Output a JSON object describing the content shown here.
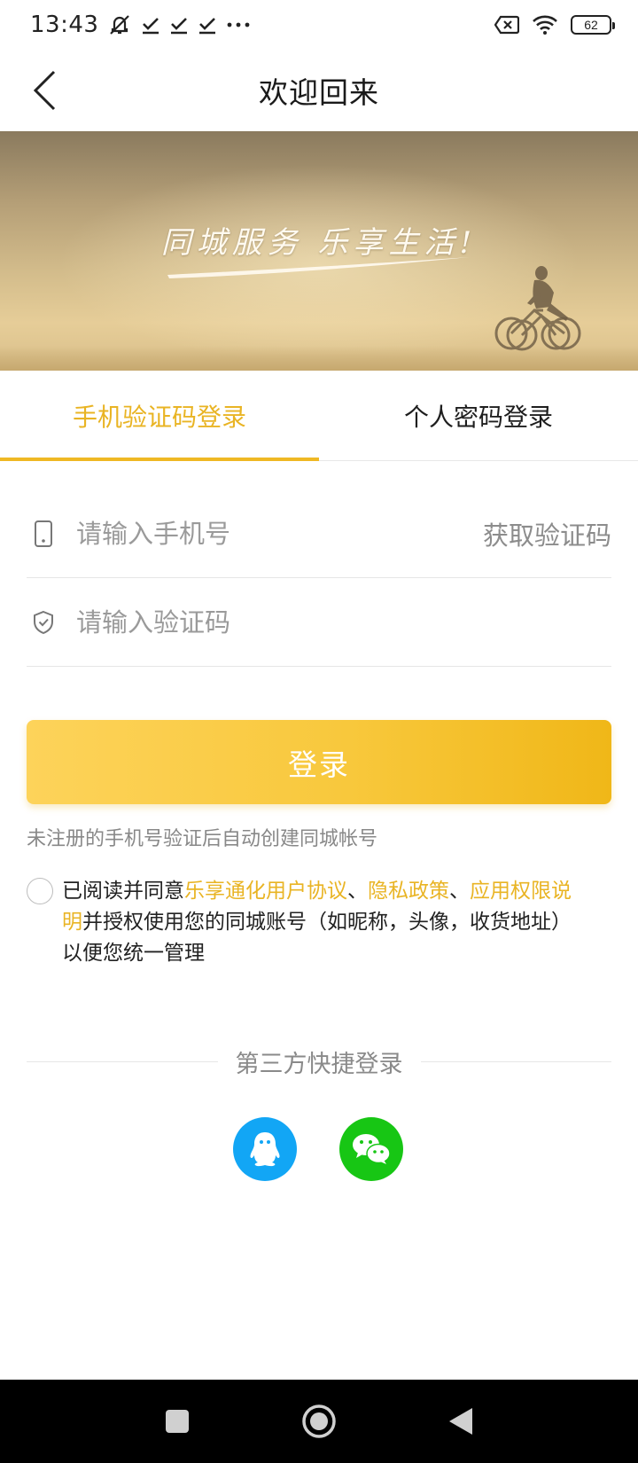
{
  "status_bar": {
    "time": "13:43",
    "battery": "62",
    "icons": [
      "mute-icon",
      "check-icon",
      "check-icon",
      "check-icon",
      "more-icon",
      "no-sim-icon",
      "wifi-icon",
      "battery-icon"
    ]
  },
  "header": {
    "title": "欢迎回来",
    "back_icon": "chevron-left-icon"
  },
  "banner": {
    "slogan": "同城服务 乐享生活!"
  },
  "tabs": [
    {
      "label": "手机验证码登录",
      "active": true
    },
    {
      "label": "个人密码登录",
      "active": false
    }
  ],
  "form": {
    "phone_placeholder": "请输入手机号",
    "phone_value": "",
    "get_code_label": "获取验证码",
    "code_placeholder": "请输入验证码",
    "code_value": ""
  },
  "login_button": "登录",
  "hint": "未注册的手机号验证后自动创建同城帐号",
  "agreement": {
    "checked": false,
    "prefix": "已阅读并同意",
    "link1": "乐享通化用户协议",
    "sep1": "、",
    "link2": "隐私政策",
    "sep2": "、",
    "link3": "应用权限说明",
    "suffix": "并授权使用您的同城账号（如昵称，头像，收货地址）以便您统一管理"
  },
  "third_party": {
    "label": "第三方快捷登录",
    "providers": [
      "qq-icon",
      "wechat-icon"
    ]
  },
  "colors": {
    "accent": "#e9b424",
    "button_start": "#fdd35a",
    "button_end": "#f0b718",
    "qq": "#12a6f5",
    "wechat": "#17c614"
  }
}
